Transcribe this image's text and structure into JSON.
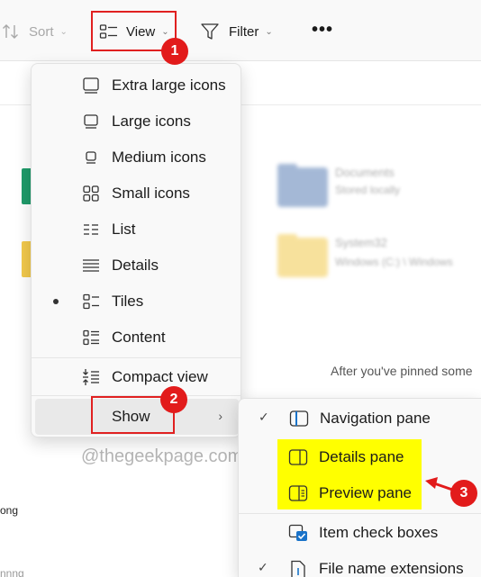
{
  "toolbar": {
    "sort_label": "Sort",
    "view_label": "View",
    "filter_label": "Filter",
    "more_label": "•••"
  },
  "view_menu": {
    "items": [
      {
        "label": "Extra large icons",
        "icon": "extra-large-icons-icon"
      },
      {
        "label": "Large icons",
        "icon": "large-icons-icon"
      },
      {
        "label": "Medium icons",
        "icon": "medium-icons-icon"
      },
      {
        "label": "Small icons",
        "icon": "small-icons-icon"
      },
      {
        "label": "List",
        "icon": "list-icon"
      },
      {
        "label": "Details",
        "icon": "details-icon"
      },
      {
        "label": "Tiles",
        "icon": "tiles-icon",
        "selected": true
      },
      {
        "label": "Content",
        "icon": "content-icon"
      }
    ],
    "compact_label": "Compact view",
    "show_label": "Show"
  },
  "show_menu": {
    "items": [
      {
        "label": "Navigation pane",
        "checked": true,
        "icon": "navigation-pane-icon"
      },
      {
        "label": "Details pane",
        "checked": false,
        "icon": "details-pane-icon"
      },
      {
        "label": "Preview pane",
        "checked": false,
        "icon": "preview-pane-icon"
      },
      {
        "label": "Item check boxes",
        "checked": false,
        "icon": "item-check-boxes-icon"
      },
      {
        "label": "File name extensions",
        "checked": true,
        "icon": "file-name-extensions-icon"
      }
    ]
  },
  "background": {
    "pinned_text": "After you've pinned some",
    "fragment_1": "ong",
    "fragment_2": "nnng",
    "blurred_title_1": "Documents",
    "blurred_sub_1": "Stored locally",
    "blurred_title_2": "System32",
    "blurred_sub_2": "Windows (C:) \\ Windows"
  },
  "watermark": "@thegeekpage.com",
  "annotations": {
    "badge_1": "1",
    "badge_2": "2",
    "badge_3": "3",
    "annotation_color": "#e21b1b",
    "highlight_color": "#ffff00"
  }
}
